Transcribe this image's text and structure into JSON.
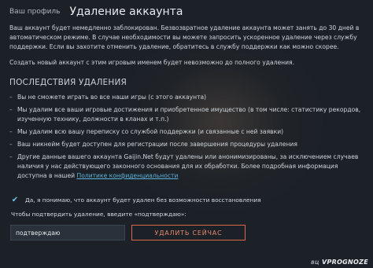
{
  "header": {
    "breadcrumb": "Ваш профиль",
    "title": "Удаление аккаунта"
  },
  "intro": "Ваш аккаунт будет немедленно заблокирован. Безвозвратное удаление аккаунта может занять до 30 дней в автоматическом режиме. В случае необходимости вы можете запросить ускоренное удаление через службу поддержки. Если вы захотите отменить удаление, обратитесь в службу поддержки как можно скорее.",
  "info_line": "Создать новый аккаунт с этим игровым именем будет невозможно до полного удаления.",
  "consequences": {
    "heading": "ПОСЛЕДСТВИЯ УДАЛЕНИЯ",
    "items": [
      "Вы не сможете играть во все наши игры (с этого аккаунта)",
      "Мы удалим все ваши игровые достижения и приобретенное имущество (в том числе: статистику рекордов, изученную технику, должности в кланах и т.п.)",
      "Мы удалим всю вашу переписку со службой поддержки (и связанные с ней заявки)",
      "Ваш никнейм будет доступен для регистрации после завершения процедуры удаления",
      "Другие данные вашего аккаунта Gaijin.Net будут удалены или анонимизированы, за исключением случаев наличия у нас действующего законного основания для их обработки. Более подробная информация доступна в нашей"
    ],
    "policy_link": "Политике конфиденциальности"
  },
  "confirm": {
    "checkbox_label": "Да, я понимаю, что аккаунт будет удален без возможности восстановления",
    "checked": true,
    "prompt": "Чтобы подтвердить удаление, введите «подтверждаю»:",
    "input_value": "подтверждаю",
    "button_label": "Удалить сейчас"
  },
  "watermark": {
    "prefix": "ВЦ",
    "text": "VPROGNOZE"
  },
  "colors": {
    "background": "#1b2127",
    "accent_link": "#5fb2d9",
    "danger": "#d9694a",
    "checkbox": "#6fc3e6"
  }
}
